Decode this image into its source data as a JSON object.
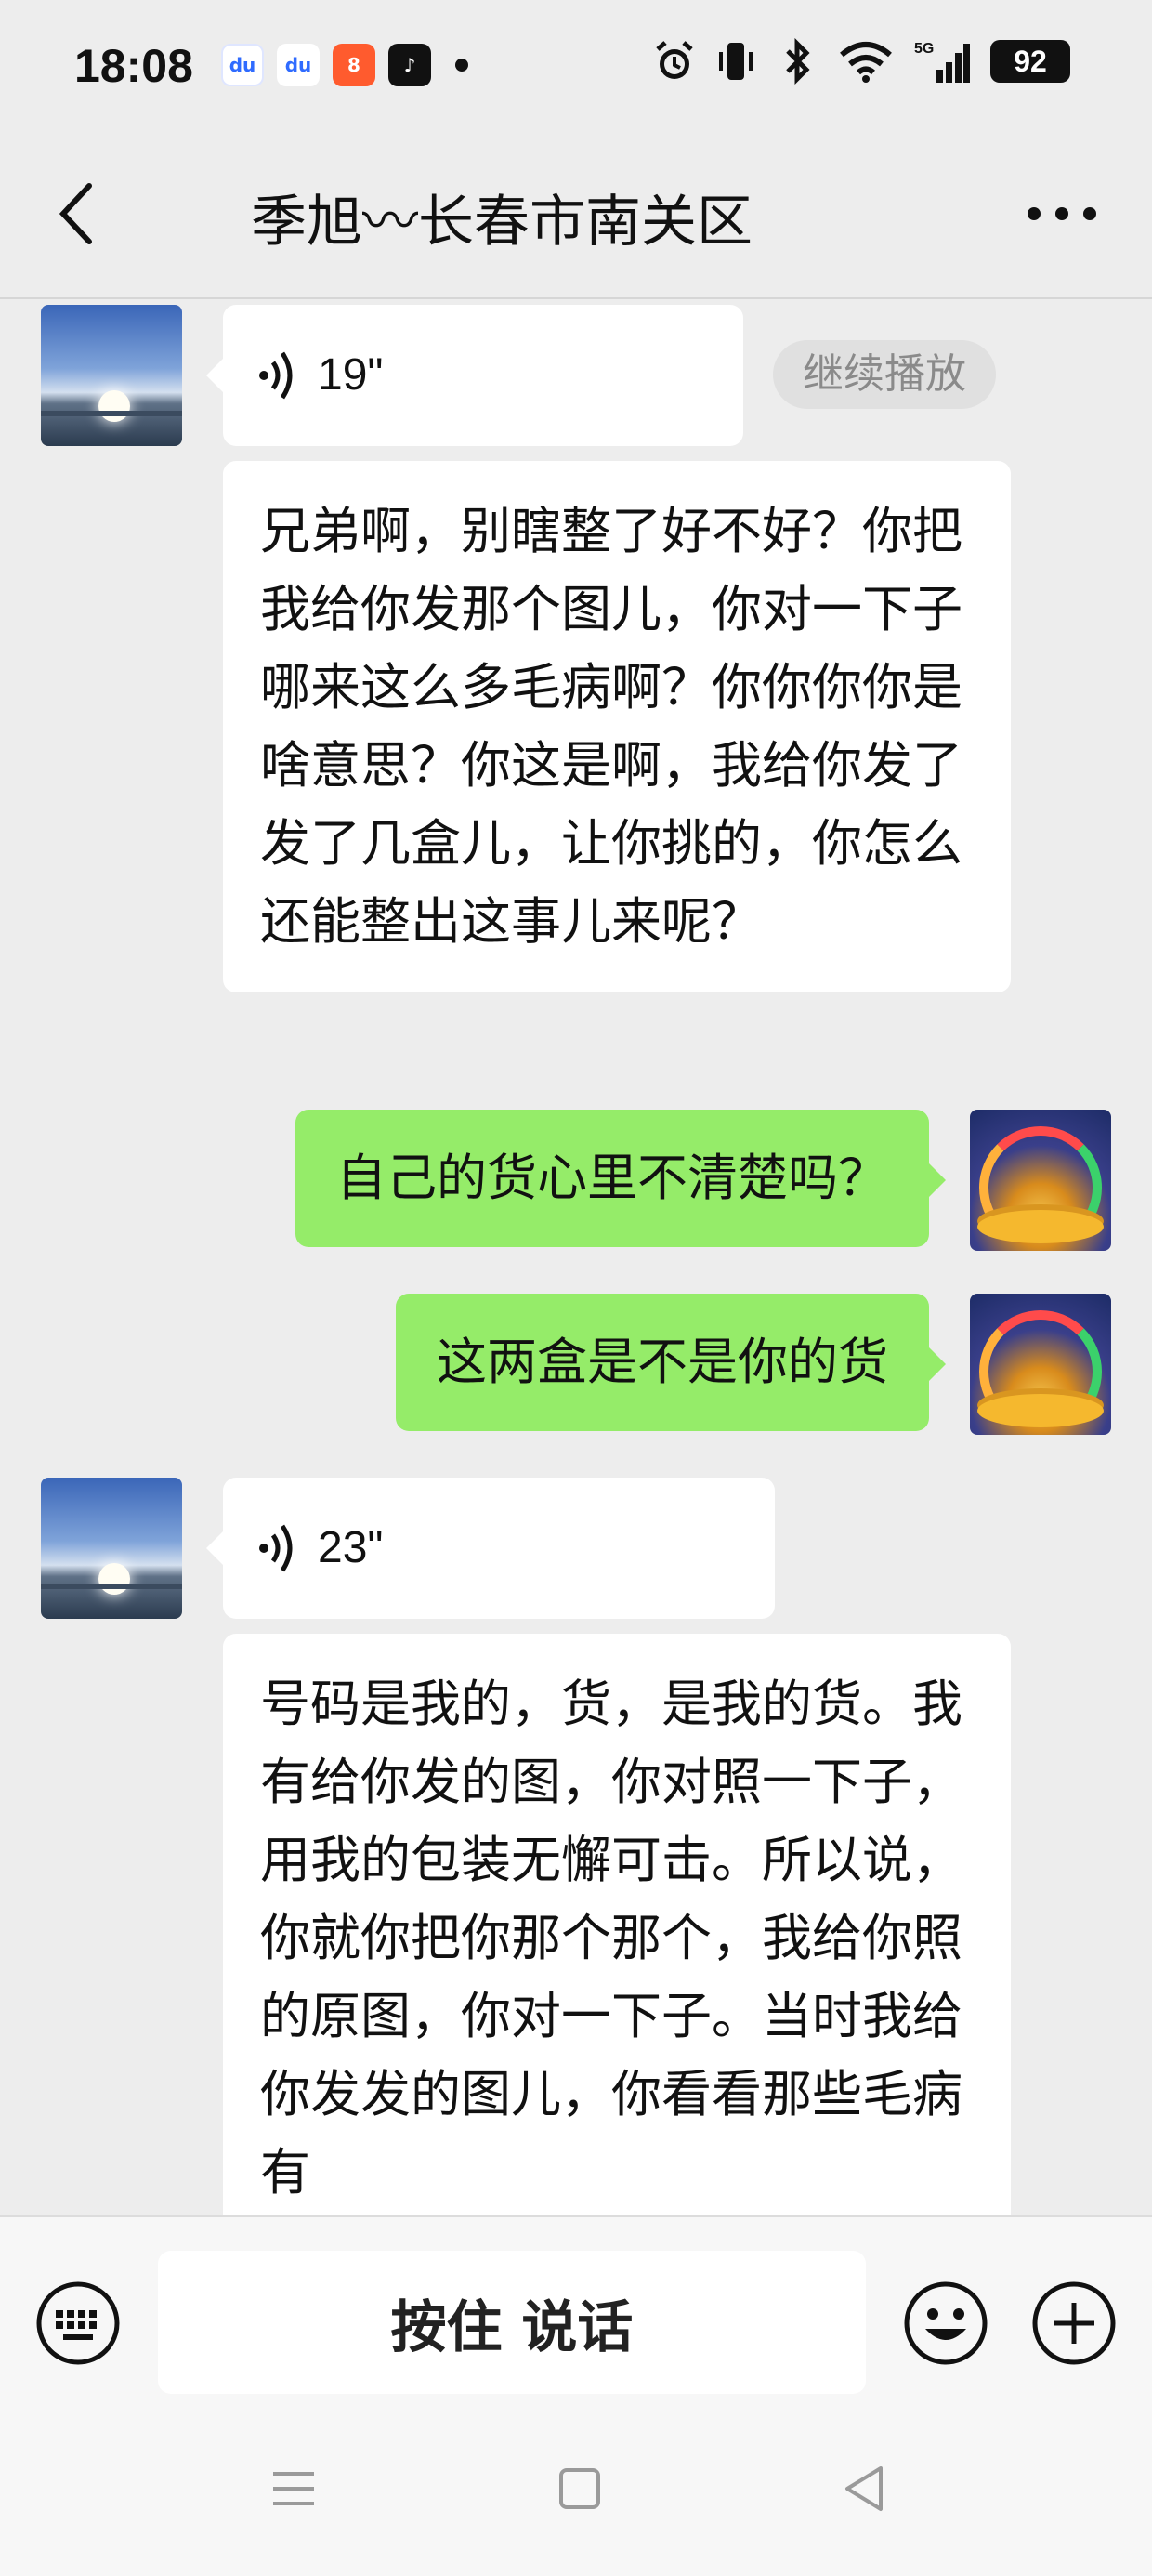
{
  "status_bar": {
    "time": "18:08",
    "battery": "92",
    "network": "5G",
    "app_icons": [
      "baidu-icon",
      "baidu-icon",
      "xiaohongshu-icon",
      "tiktok-icon"
    ]
  },
  "nav": {
    "title": "季旭〰长春市南关区"
  },
  "messages": {
    "voice1": {
      "duration": "19\"",
      "continue_label": "继续播放"
    },
    "text1": "兄弟啊，别瞎整了好不好？你把我给你发那个图儿，你对一下子哪来这么多毛病啊？你你你你是啥意思？你这是啊，我给你发了发了几盒儿，让你挑的，你怎么还能整出这事儿来呢？",
    "my1": "自己的货心里不清楚吗？",
    "my2": "这两盒是不是你的货",
    "voice2": {
      "duration": "23\""
    },
    "text2": "号码是我的，货，是我的货。我有给你发的图，你对照一下子，用我的包装无懈可击。所以说，你就你把你那个那个，我给你照的原图，你对一下子。当时我给你发发的图儿，你看看那些毛病有"
  },
  "input_bar": {
    "hold_to_talk": "按住 说话"
  },
  "colors": {
    "background": "#ededed",
    "my_bubble": "#95ec69",
    "their_bubble": "#ffffff"
  }
}
